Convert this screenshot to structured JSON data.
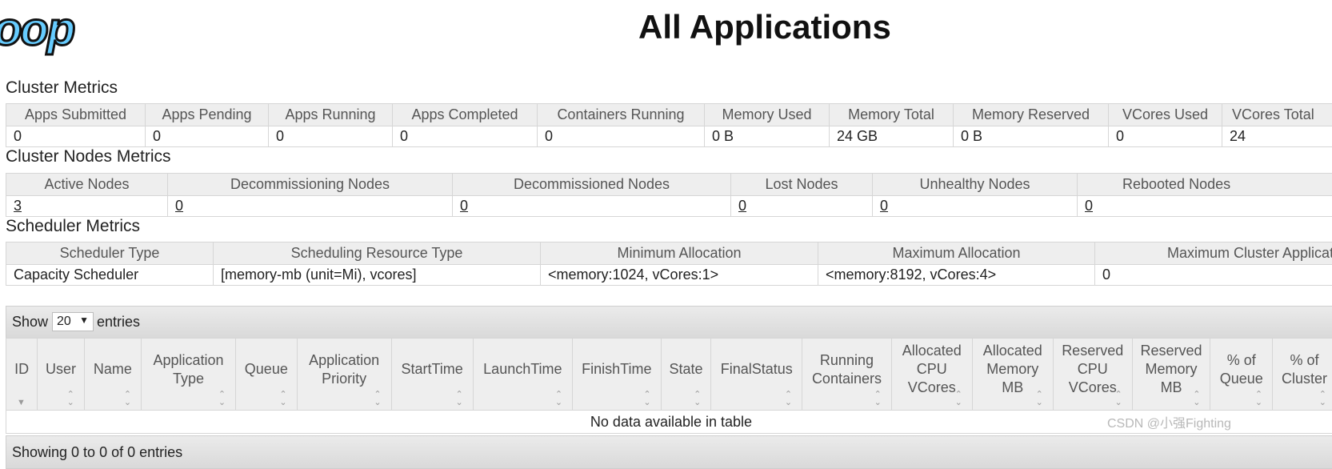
{
  "logo_text": "hadoop",
  "page_title": "All Applications",
  "cluster_metrics": {
    "title": "Cluster Metrics",
    "headers": [
      "Apps Submitted",
      "Apps Pending",
      "Apps Running",
      "Apps Completed",
      "Containers Running",
      "Memory Used",
      "Memory Total",
      "Memory Reserved",
      "VCores Used",
      "VCores Total"
    ],
    "values": [
      "0",
      "0",
      "0",
      "0",
      "0",
      "0 B",
      "24 GB",
      "0 B",
      "0",
      "24"
    ]
  },
  "cluster_nodes_metrics": {
    "title": "Cluster Nodes Metrics",
    "headers": [
      "Active Nodes",
      "Decommissioning Nodes",
      "Decommissioned Nodes",
      "Lost Nodes",
      "Unhealthy Nodes",
      "Rebooted Nodes"
    ],
    "values": [
      "3",
      "0",
      "0",
      "0",
      "0",
      "0"
    ]
  },
  "scheduler_metrics": {
    "title": "Scheduler Metrics",
    "headers": [
      "Scheduler Type",
      "Scheduling Resource Type",
      "Minimum Allocation",
      "Maximum Allocation",
      "Maximum Cluster Application Priority"
    ],
    "values": [
      "Capacity Scheduler",
      "[memory-mb (unit=Mi), vcores]",
      "<memory:1024, vCores:1>",
      "<memory:8192, vCores:4>",
      "0"
    ]
  },
  "apps_table": {
    "show_label": "Show",
    "entries_value": "20",
    "entries_label": "entries",
    "columns": [
      "ID",
      "User",
      "Name",
      "Application Type",
      "Queue",
      "Application Priority",
      "StartTime",
      "LaunchTime",
      "FinishTime",
      "State",
      "FinalStatus",
      "Running Containers",
      "Allocated CPU VCores",
      "Allocated Memory MB",
      "Reserved CPU VCores",
      "Reserved Memory MB",
      "% of Queue",
      "% of Cluster"
    ],
    "empty_message": "No data available in table",
    "footer_text": "Showing 0 to 0 of 0 entries"
  },
  "watermark": "CSDN @小强Fighting",
  "colors": {
    "logo_fill": "#66ccff",
    "logo_outline": "#111111",
    "header_bg": "#eeeeee",
    "border": "#d6d6d6"
  }
}
